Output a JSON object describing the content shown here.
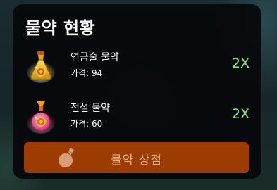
{
  "panel": {
    "title": "물약 현황"
  },
  "potions": [
    {
      "icon": "alchemy-potion-icon",
      "name": "연금술 물약",
      "price": "가격: 94",
      "count": "2X"
    },
    {
      "icon": "legendary-potion-icon",
      "name": "전설 물약",
      "price": "가격: 60",
      "count": "2X"
    }
  ],
  "shop_button": {
    "label": "물약 상점",
    "icon": "potion-flask-icon"
  },
  "colors": {
    "panel_bg": "#06080b",
    "count_green": "#86ee86",
    "button_bg": "#9c3c00",
    "button_text": "#e1b28a"
  }
}
